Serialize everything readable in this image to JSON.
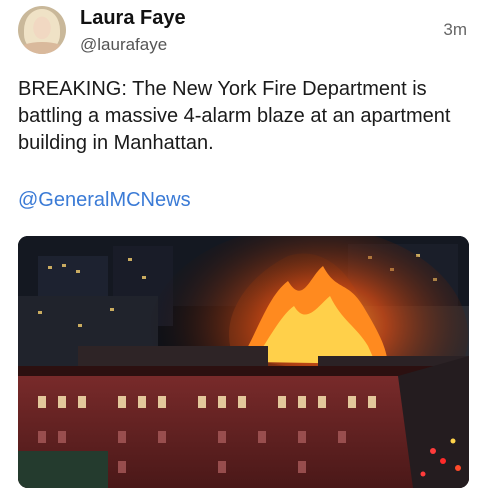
{
  "post": {
    "author_name": "Laura Faye",
    "handle": "@laurafaye",
    "time": "3m",
    "text": "BREAKING: The New York Fire Department is battling a massive 4-alarm blaze at an apartment building in Manhattan.",
    "mention": "@GeneralMCNews",
    "avatar_icon": "user-avatar",
    "media_icon": "photo-fire-apartment-building"
  }
}
